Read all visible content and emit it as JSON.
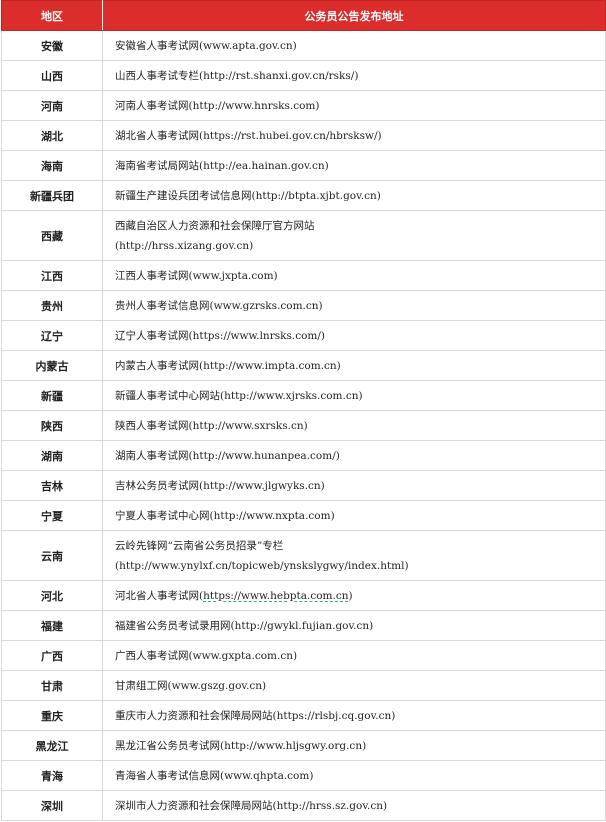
{
  "header": {
    "region": "地区",
    "address": "公务员公告发布地址"
  },
  "rows": [
    {
      "region": "安徽",
      "address": "安徽省人事考试网(www.apta.gov.cn)"
    },
    {
      "region": "山西",
      "address": "山西人事考试专栏(http://rst.shanxi.gov.cn/rsks/)"
    },
    {
      "region": "河南",
      "address": "河南人事考试网(http://www.hnrsks.com)"
    },
    {
      "region": "湖北",
      "address": "湖北省人事考试网(https://rst.hubei.gov.cn/hbrsksw/)"
    },
    {
      "region": "海南",
      "address": "海南省考试局网站(http://ea.hainan.gov.cn)"
    },
    {
      "region": "新疆兵团",
      "address": "新疆生产建设兵团考试信息网(http://btpta.xjbt.gov.cn)"
    },
    {
      "region": "西藏",
      "address_line1": "西藏自治区人力资源和社会保障厅官方网站",
      "address_line2": "(http://hrss.xizang.gov.cn)"
    },
    {
      "region": "江西",
      "address": "江西人事考试网(www.jxpta.com)"
    },
    {
      "region": "贵州",
      "address": "贵州人事考试信息网(www.gzrsks.com.cn)"
    },
    {
      "region": "辽宁",
      "address": "辽宁人事考试网(https://www.lnrsks.com/)"
    },
    {
      "region": "内蒙古",
      "address": "内蒙古人事考试网(http://www.impta.com.cn)"
    },
    {
      "region": "新疆",
      "address": "新疆人事考试中心网站(http://www.xjrsks.com.cn)"
    },
    {
      "region": "陕西",
      "address": "陕西人事考试网(http://www.sxrsks.cn)"
    },
    {
      "region": "湖南",
      "address": "湖南人事考试网(http://www.hunanpea.com/)"
    },
    {
      "region": "吉林",
      "address": "吉林公务员考试网(http://www.jlgwyks.cn)"
    },
    {
      "region": "宁夏",
      "address": "宁夏人事考试中心网(http://www.nxpta.com)"
    },
    {
      "region": "云南",
      "address_line1": "云岭先锋网“云南省公务员招录”专栏",
      "address_line2": "(http://www.ynylxf.cn/topicweb/ynskslygwy/index.html)"
    },
    {
      "region": "河北",
      "address_prefix": "河北省人事考试网(",
      "address_link": "https://www.hebpta.com.cn",
      "address_suffix": ")"
    },
    {
      "region": "福建",
      "address": "福建省公务员考试录用网(http://gwykl.fujian.gov.cn)"
    },
    {
      "region": "广西",
      "address": "广西人事考试网(www.gxpta.com.cn)"
    },
    {
      "region": "甘肃",
      "address": "甘肃组工网(www.gszg.gov.cn)"
    },
    {
      "region": "重庆",
      "address": "重庆市人力资源和社会保障局网站(https://rlsbj.cq.gov.cn)"
    },
    {
      "region": "黑龙江",
      "address": "黑龙江省公务员考试网(http://www.hljsgwy.org.cn)"
    },
    {
      "region": "青海",
      "address": "青海省人事考试信息网(www.qhpta.com)"
    },
    {
      "region": "深圳",
      "address": "深圳市人力资源和社会保障局网站(http://hrss.sz.gov.cn)"
    }
  ]
}
